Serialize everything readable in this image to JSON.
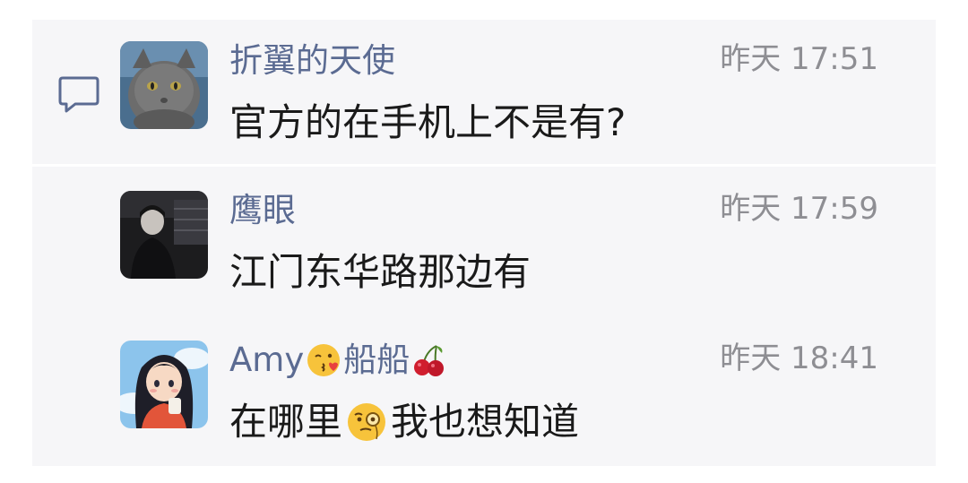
{
  "comments": [
    {
      "username": "折翼的天使",
      "time": "昨天 17:51",
      "message": "官方的在手机上不是有?",
      "avatar": "gray-cat-avatar"
    },
    {
      "username": "鹰眼",
      "time": "昨天 17:59",
      "message": "江门东华路那边有",
      "avatar": "dark-figure-avatar"
    },
    {
      "username_prefix": "Amy",
      "username_middle": "船船",
      "username_emojis": [
        "kissing-face-emoji",
        "cherries-emoji"
      ],
      "time": "昨天 18:41",
      "message_before": "在哪里",
      "message_after": "我也想知道",
      "message_emoji": "face-with-monocle-emoji",
      "avatar": "anime-girl-avatar"
    }
  ],
  "icons": {
    "comment": "comment-bubble-icon"
  },
  "colors": {
    "username": "#5b6b92",
    "time": "#8e8e93",
    "message": "#1a1a1a",
    "panel_background": "#f6f6f8"
  }
}
